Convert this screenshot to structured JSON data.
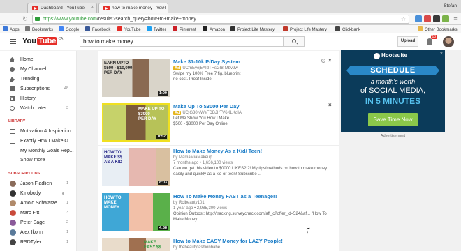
{
  "browser": {
    "tabs": [
      {
        "title": "Dashboard - YouTube",
        "active": false
      },
      {
        "title": "how to make money - YouT",
        "active": true
      }
    ],
    "profile_name": "Stefan",
    "url_host": "https://www.youtube.com",
    "url_path": "/results?search_query=how+to+make+money",
    "bookmarks": [
      "Apps",
      "Bookmarks",
      "Google",
      "Facebook",
      "YouTube",
      "Twitter",
      "Pinterest",
      "Amazon",
      "Project Life Mastery",
      "Project Life Mastery",
      "Clickbank",
      "Other Bookmarks"
    ]
  },
  "header": {
    "logo_you": "You",
    "logo_tube": "Tube",
    "country": "CA",
    "search_value": "how to make money",
    "upload_label": "Upload",
    "notification_count": "13"
  },
  "guide": {
    "main_items": [
      {
        "label": "Home",
        "count": ""
      },
      {
        "label": "My Channel",
        "count": ""
      },
      {
        "label": "Trending",
        "count": ""
      },
      {
        "label": "Subscriptions",
        "count": "48"
      },
      {
        "label": "History",
        "count": ""
      },
      {
        "label": "Watch Later",
        "count": "3"
      }
    ],
    "library_heading": "LIBRARY",
    "library_items": [
      {
        "label": "Motivation & Inspiration",
        "count": ""
      },
      {
        "label": "Exactly How I Make O...",
        "count": "1"
      },
      {
        "label": "My Monthly Goals Rep...",
        "count": "1"
      }
    ],
    "show_more": "Show more",
    "subscriptions_heading": "SUBSCRIPTIONS",
    "subscriptions": [
      {
        "label": "Jason Fladlien",
        "count": "1"
      },
      {
        "label": "Kinobody",
        "count": ""
      },
      {
        "label": "Arnold Schwarze...",
        "count": "1"
      },
      {
        "label": "Marc Fitt",
        "count": "3"
      },
      {
        "label": "Peter Sage",
        "count": "2"
      },
      {
        "label": "Alex Ikonn",
        "count": "1"
      },
      {
        "label": "RSDTyler",
        "count": "1"
      }
    ]
  },
  "results": [
    {
      "title": "Make $1-10k P/Day System",
      "ad": true,
      "channel": "UCmEyej5AIdTHsGI8-Mbv9w",
      "meta": "",
      "desc": "Swipe my 100% Free 7 fig. blueprint\nno cost. Proof Inside!",
      "duration": "1:09",
      "thumb_text": "EARN UPTO\n$500 - $10,000\nPER DAY",
      "colors": [
        "#d9d4c9",
        "#8a6a52"
      ]
    },
    {
      "title": "Make Up To $3000 Per Day",
      "ad": true,
      "channel": "UCjG30NWeFDBJIrTV6KLKdIA",
      "meta": "",
      "desc": "Let Me Show You How I Make\n$500 - $3000 Per Day Online!",
      "duration": "0:52",
      "thumb_text": "MAKE UP TO\n$3000\nPER DAY",
      "colors": [
        "#c6d26a",
        "#7a5a3c"
      ]
    },
    {
      "title": "How to Make Money As a Kid/ Teen!",
      "ad": false,
      "channel": "by MamaMiaMakeup",
      "meta": "7 months ago  •  1,636,100 views",
      "desc": "Can we get this video to $0000 LIKES?!?! My tips/methods on how to make money\neasily and quickly as a kid or teen! Subscribe ...",
      "duration": "8:03",
      "thumb_text": "HOW TO\nMAKE $$\nAS A KID",
      "colors": [
        "#e8eef4",
        "#e6b8b0"
      ]
    },
    {
      "title": "How To Make Money FAST as a Teenager!",
      "ad": false,
      "channel": "by Rclbeauty101",
      "meta": "1 year ago  •  2,985,300 views",
      "desc": "Opinion Outpost: http://tracking.surveycheck.com/aff_c?offer_id=524&af... \"How To\nMake Money ...",
      "duration": "4:58",
      "thumb_text": "HOW TO\nMAKE\nMONEY",
      "colors": [
        "#3fa7d6",
        "#f2c0a8"
      ]
    },
    {
      "title": "How to Make EASY Money for LAZY People!",
      "ad": false,
      "channel": "by thebeautyfashionbabe",
      "meta": "",
      "desc": "",
      "duration": "",
      "thumb_text": "MAKE\nEASY $$",
      "colors": [
        "#e9dccb",
        "#a07050"
      ]
    }
  ],
  "ad_panel": {
    "brand": "Hootsuite",
    "ribbon": "SCHEDULE",
    "line1": "a month's worth",
    "line2": "of SOCIAL MEDIA,",
    "line3": "IN 5 MINUTES",
    "cta": "Save Time Now",
    "label": "Advertisement",
    "accent": "#2a88c8"
  },
  "colors": {
    "youtube_red": "#e52d27",
    "link_blue": "#167ac6",
    "ad_yellow": "#e5b41b"
  }
}
